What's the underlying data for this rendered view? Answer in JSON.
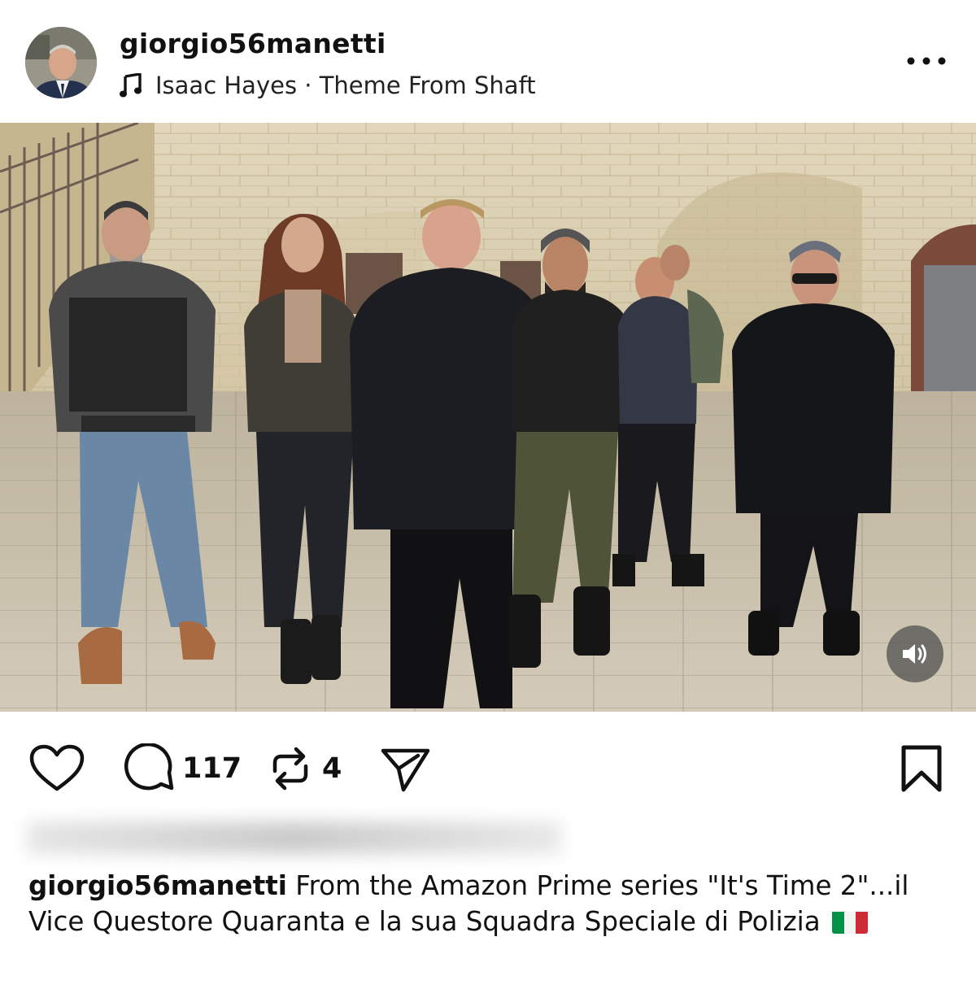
{
  "post": {
    "author": {
      "username": "giorgio56manetti",
      "avatar_icon": "avatar-photo"
    },
    "audio": {
      "icon": "music-note-icon",
      "label": "Isaac Hayes · Theme From Shaft"
    },
    "more_icon": "more-horizontal-icon",
    "media": {
      "sound_icon": "speaker-icon"
    },
    "actions": {
      "like_icon": "heart-icon",
      "comment_icon": "comment-icon",
      "comment_count": "117",
      "repost_icon": "repost-icon",
      "repost_count": "4",
      "share_icon": "send-icon",
      "save_icon": "bookmark-icon"
    },
    "caption": {
      "username": "giorgio56manetti",
      "text": " From the Amazon Prime series \"It's Time 2\"...il Vice Questore Quaranta e la sua Squadra Speciale di Polizia ",
      "flag": "Italian flag"
    }
  },
  "colors": {
    "text": "#111111",
    "secondary": "#222222",
    "background": "#ffffff",
    "flag_green": "#009246",
    "flag_white": "#ffffff",
    "flag_red": "#ce2b37"
  }
}
